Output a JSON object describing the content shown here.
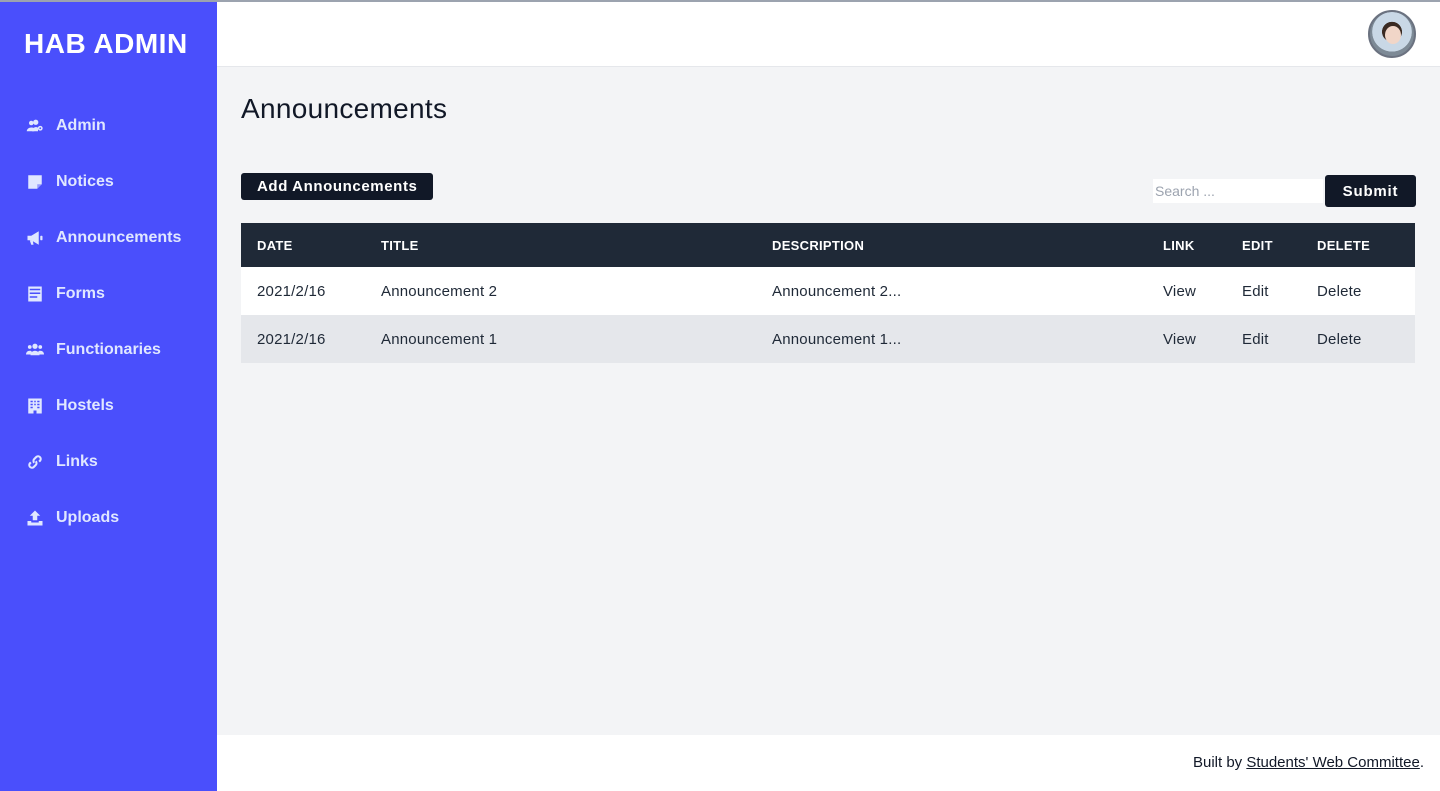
{
  "sidebar": {
    "brand": "HAB ADMIN",
    "items": [
      {
        "label": "Admin",
        "icon": "users-cog-icon"
      },
      {
        "label": "Notices",
        "icon": "sticky-note-icon"
      },
      {
        "label": "Announcements",
        "icon": "megaphone-icon"
      },
      {
        "label": "Forms",
        "icon": "form-icon"
      },
      {
        "label": "Functionaries",
        "icon": "users-icon"
      },
      {
        "label": "Hostels",
        "icon": "building-icon"
      },
      {
        "label": "Links",
        "icon": "link-icon"
      },
      {
        "label": "Uploads",
        "icon": "upload-icon"
      }
    ],
    "accent": "#4a4ffc"
  },
  "main": {
    "title": "Announcements",
    "add_label": "Add Announcements",
    "search_placeholder": "Search ...",
    "submit_label": "Submit",
    "table": {
      "headers": [
        "DATE",
        "TITLE",
        "DESCRIPTION",
        "LINK",
        "EDIT",
        "DELETE"
      ],
      "rows": [
        {
          "date": "2021/2/16",
          "title": "Announcement 2",
          "description": "Announcement 2...",
          "link": "View",
          "edit": "Edit",
          "delete": "Delete"
        },
        {
          "date": "2021/2/16",
          "title": "Announcement 1",
          "description": "Announcement 1...",
          "link": "View",
          "edit": "Edit",
          "delete": "Delete"
        }
      ]
    }
  },
  "footer": {
    "prefix": "Built by ",
    "link_text": "Students' Web Committee",
    "suffix": "."
  }
}
